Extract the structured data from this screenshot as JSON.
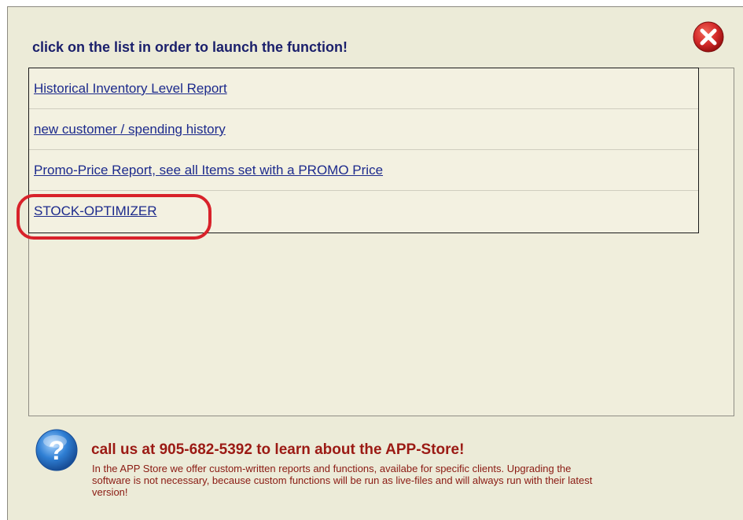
{
  "header": {
    "prompt": "click on the list in order to launch the function!"
  },
  "functions": [
    {
      "label": "Historical Inventory Level Report"
    },
    {
      "label": "new customer / spending history"
    },
    {
      "label": "Promo-Price Report, see all Items set with a PROMO Price"
    },
    {
      "label": "STOCK-OPTIMIZER"
    }
  ],
  "highlighted_item": "STOCK-OPTIMIZER",
  "footer": {
    "title": "call us at 905-682-5392 to learn about the APP-Store!",
    "description": "In the APP Store we offer custom-written reports and functions, availabe for specific clients. Upgrading the software is not necessary, because custom functions will be run as live-files and will always run with their latest version!"
  },
  "colors": {
    "dialog_bg": "#ecebd8",
    "link": "#1c2a8c",
    "prompt": "#1a1f6b",
    "footer_text": "#9b1a14",
    "highlight": "#d8222a",
    "close_button": "#d42a2a",
    "info_icon": "#2f7fd4"
  },
  "icons": {
    "close": "close-icon",
    "info": "question-mark-icon"
  }
}
